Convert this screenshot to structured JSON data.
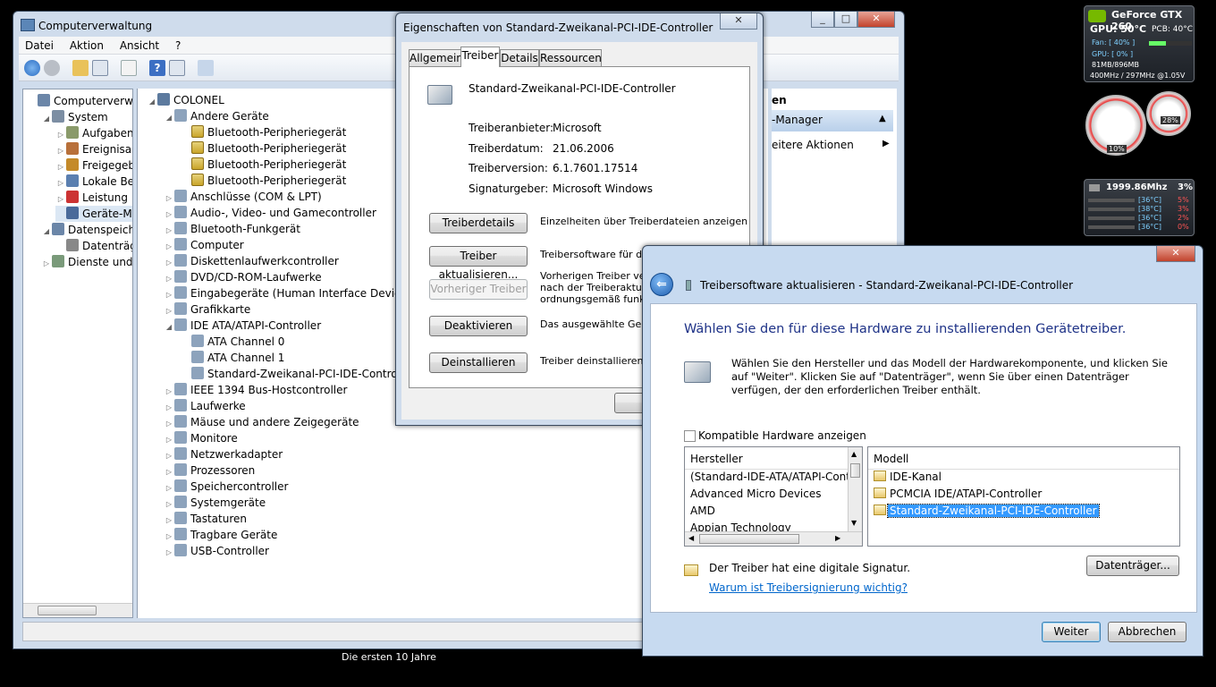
{
  "taskbar_caption": "Die ersten 10 Jahre",
  "gpu_gadget": {
    "title": "GeForce GTX 260",
    "temp_line": "GPU: 50°C",
    "pcb": "PCB: 40°C",
    "fan": "Fan: [ 40% ]",
    "gpu_load": "GPU: [ 0% ]",
    "memory": "81MB/896MB",
    "clocks": "400MHz / 297MHz @1.05V"
  },
  "meter_gadget": {
    "left_pct": "10%",
    "right_pct": "28%"
  },
  "cpu_gadget": {
    "freq": "1999.86Mhz",
    "load": "3%",
    "cores": [
      {
        "temp": "[36°C]",
        "pct": "5%"
      },
      {
        "temp": "[38°C]",
        "pct": "3%"
      },
      {
        "temp": "[36°C]",
        "pct": "2%"
      },
      {
        "temp": "[36°C]",
        "pct": "0%"
      }
    ]
  },
  "mmc": {
    "title": "Computerverwaltung",
    "menu": [
      "Datei",
      "Aktion",
      "Ansicht",
      "?"
    ],
    "left_tree": [
      {
        "label": "Computerverwaltu",
        "indent": 0,
        "tri": ""
      },
      {
        "label": "System",
        "indent": 1,
        "tri": "◢"
      },
      {
        "label": "Aufgabenp",
        "indent": 2,
        "tri": "▷"
      },
      {
        "label": "Ereignisan",
        "indent": 2,
        "tri": "▷"
      },
      {
        "label": "Freigegebe",
        "indent": 2,
        "tri": "▷"
      },
      {
        "label": "Lokale Ben",
        "indent": 2,
        "tri": "▷"
      },
      {
        "label": "Leistung",
        "indent": 2,
        "tri": "▷"
      },
      {
        "label": "Geräte-Ma",
        "indent": 2,
        "tri": ""
      },
      {
        "label": "Datenspeicher",
        "indent": 1,
        "tri": "◢"
      },
      {
        "label": "Datenträge",
        "indent": 2,
        "tri": ""
      },
      {
        "label": "Dienste und A",
        "indent": 1,
        "tri": "▷"
      }
    ],
    "device_tree": [
      {
        "label": "COLONEL",
        "indent": 0,
        "tri": "◢"
      },
      {
        "label": "Andere Geräte",
        "indent": 1,
        "tri": "◢"
      },
      {
        "label": "Bluetooth-Peripheriegerät",
        "indent": 2,
        "tri": "",
        "warn": true
      },
      {
        "label": "Bluetooth-Peripheriegerät",
        "indent": 2,
        "tri": "",
        "warn": true
      },
      {
        "label": "Bluetooth-Peripheriegerät",
        "indent": 2,
        "tri": "",
        "warn": true
      },
      {
        "label": "Bluetooth-Peripheriegerät",
        "indent": 2,
        "tri": "",
        "warn": true
      },
      {
        "label": "Anschlüsse (COM & LPT)",
        "indent": 1,
        "tri": "▷"
      },
      {
        "label": "Audio-, Video- und Gamecontroller",
        "indent": 1,
        "tri": "▷"
      },
      {
        "label": "Bluetooth-Funkgerät",
        "indent": 1,
        "tri": "▷"
      },
      {
        "label": "Computer",
        "indent": 1,
        "tri": "▷"
      },
      {
        "label": "Diskettenlaufwerkcontroller",
        "indent": 1,
        "tri": "▷"
      },
      {
        "label": "DVD/CD-ROM-Laufwerke",
        "indent": 1,
        "tri": "▷"
      },
      {
        "label": "Eingabegeräte (Human Interface Devices)",
        "indent": 1,
        "tri": "▷"
      },
      {
        "label": "Grafikkarte",
        "indent": 1,
        "tri": "▷"
      },
      {
        "label": "IDE ATA/ATAPI-Controller",
        "indent": 1,
        "tri": "◢"
      },
      {
        "label": "ATA Channel 0",
        "indent": 2,
        "tri": ""
      },
      {
        "label": "ATA Channel 1",
        "indent": 2,
        "tri": ""
      },
      {
        "label": "Standard-Zweikanal-PCI-IDE-Controller",
        "indent": 2,
        "tri": ""
      },
      {
        "label": "IEEE 1394 Bus-Hostcontroller",
        "indent": 1,
        "tri": "▷"
      },
      {
        "label": "Laufwerke",
        "indent": 1,
        "tri": "▷"
      },
      {
        "label": "Mäuse und andere Zeigegeräte",
        "indent": 1,
        "tri": "▷"
      },
      {
        "label": "Monitore",
        "indent": 1,
        "tri": "▷"
      },
      {
        "label": "Netzwerkadapter",
        "indent": 1,
        "tri": "▷"
      },
      {
        "label": "Prozessoren",
        "indent": 1,
        "tri": "▷"
      },
      {
        "label": "Speichercontroller",
        "indent": 1,
        "tri": "▷"
      },
      {
        "label": "Systemgeräte",
        "indent": 1,
        "tri": "▷"
      },
      {
        "label": "Tastaturen",
        "indent": 1,
        "tri": "▷"
      },
      {
        "label": "Tragbare Geräte",
        "indent": 1,
        "tri": "▷"
      },
      {
        "label": "USB-Controller",
        "indent": 1,
        "tri": "▷"
      }
    ],
    "actions_header": "en",
    "actions_item": "-Manager",
    "actions_more": "eitere Aktionen"
  },
  "props": {
    "title": "Eigenschaften von Standard-Zweikanal-PCI-IDE-Controller",
    "tabs": [
      "Allgemein",
      "Treiber",
      "Details",
      "Ressourcen"
    ],
    "device_name": "Standard-Zweikanal-PCI-IDE-Controller",
    "fields": [
      {
        "key": "Treiberanbieter:",
        "value": "Microsoft"
      },
      {
        "key": "Treiberdatum:",
        "value": "21.06.2006"
      },
      {
        "key": "Treiberversion:",
        "value": "6.1.7601.17514"
      },
      {
        "key": "Signaturgeber:",
        "value": "Microsoft Windows"
      }
    ],
    "buttons": [
      {
        "label": "Treiberdetails",
        "desc": [
          "Einzelheiten über Treiberdateien anzeigen"
        ],
        "disabled": false
      },
      {
        "label": "Treiber aktualisieren...",
        "desc": [
          "Treibersoftware für dieses"
        ],
        "disabled": false
      },
      {
        "label": "Vorheriger Treiber",
        "desc": [
          "Vorherigen Treiber verwen",
          "nach der Treiberaktualisie",
          "ordnungsgemäß funktionie"
        ],
        "disabled": true
      },
      {
        "label": "Deaktivieren",
        "desc": [
          "Das ausgewählte Gerät de"
        ],
        "disabled": false
      },
      {
        "label": "Deinstallieren",
        "desc": [
          "Treiber deinstallieren (Erw"
        ],
        "disabled": false
      }
    ],
    "ok_partial": "O"
  },
  "wizard": {
    "title": "Treibersoftware aktualisieren - Standard-Zweikanal-PCI-IDE-Controller",
    "heading": "Wählen Sie den für diese Hardware zu installierenden Gerätetreiber.",
    "description": "Wählen Sie den Hersteller und das Modell der Hardwarekomponente, und klicken Sie auf \"Weiter\". Klicken Sie auf \"Datenträger\", wenn Sie über einen Datenträger verfügen, der den erforderlichen Treiber enthält.",
    "compat_label": "Kompatible Hardware anzeigen",
    "hersteller_header": "Hersteller",
    "hersteller": [
      "(Standard-IDE-ATA/ATAPI-Contr",
      "Advanced Micro Devices",
      "AMD",
      "Appian Technology"
    ],
    "modell_header": "Modell",
    "modelle": [
      "IDE-Kanal",
      "PCMCIA IDE/ATAPI-Controller",
      "Standard-Zweikanal-PCI-IDE-Controller"
    ],
    "selected_model_index": 2,
    "signature_text": "Der Treiber hat eine digitale Signatur.",
    "signature_link": "Warum ist Treibersignierung wichtig?",
    "disk_button": "Datenträger...",
    "next_button": "Weiter",
    "cancel_button": "Abbrechen",
    "colors": {
      "heading": "#1e3287",
      "link": "#0066cc",
      "selection": "#3399ff"
    }
  }
}
